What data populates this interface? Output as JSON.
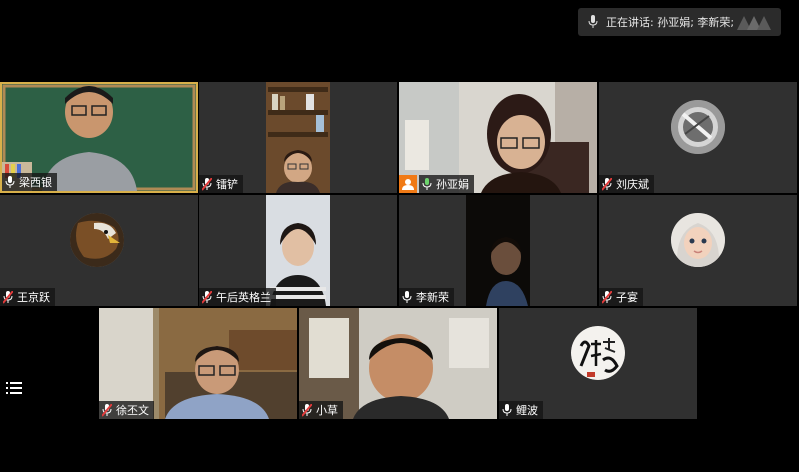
{
  "speaking": {
    "text": "正在讲话: 孙亚娟; 李新荣;"
  },
  "participants": [
    {
      "name": "梁西银",
      "mic": "unmuted"
    },
    {
      "name": "镭铲",
      "mic": "muted"
    },
    {
      "name": "孙亚娟",
      "mic": "unmuted",
      "host": true
    },
    {
      "name": "刘庆斌",
      "mic": "muted"
    },
    {
      "name": "王京跃",
      "mic": "muted"
    },
    {
      "name": "午后英格兰",
      "mic": "muted"
    },
    {
      "name": "李新荣",
      "mic": "unmuted"
    },
    {
      "name": "子宴",
      "mic": "muted"
    },
    {
      "name": "徐丕文",
      "mic": "muted"
    },
    {
      "name": "小草",
      "mic": "muted"
    },
    {
      "name": "鲤波",
      "mic": "unmuted"
    }
  ],
  "colors": {
    "active_border": "#d8b04a",
    "host_badge": "#f07a16",
    "mute_red": "#e23b3b"
  },
  "icons": {
    "menu": "menu-icon",
    "mic": "mic-icon",
    "host": "host-icon"
  }
}
